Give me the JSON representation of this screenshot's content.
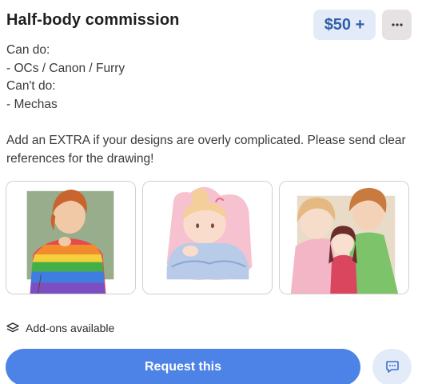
{
  "listing": {
    "title": "Half-body commission",
    "price": "$50 +",
    "description_lines": [
      "Can do:",
      "- OCs / Canon / Furry",
      "Can't do:",
      "- Mechas"
    ],
    "extra_note": "Add an EXTRA if your designs are overly complicated. Please send clear references for the drawing!",
    "addons_label": "Add-ons available",
    "request_label": "Request this"
  },
  "icons": {
    "more": "ellipsis-icon",
    "addons": "layers-icon",
    "chat": "chat-bubble-icon"
  },
  "colors": {
    "accent": "#4d83e6",
    "price_bg": "#e4ebf8",
    "price_text": "#2f5fa8"
  }
}
